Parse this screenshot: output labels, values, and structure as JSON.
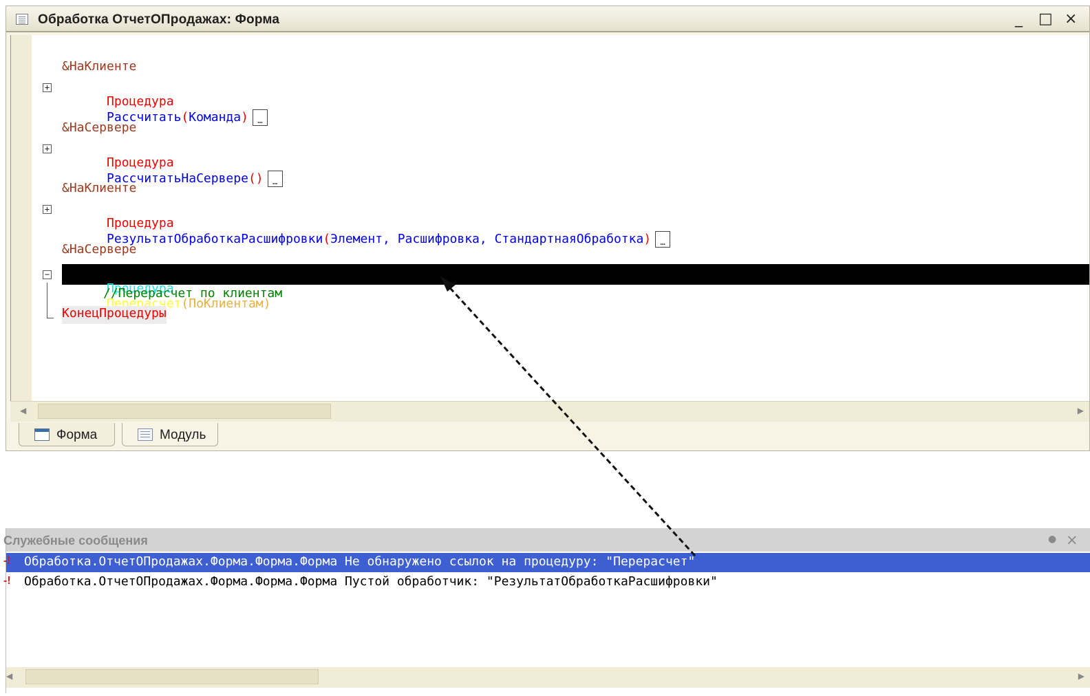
{
  "window": {
    "title": "Обработка ОтчетОПродажах: Форма",
    "minimize": "_",
    "maximize": "□",
    "close": "×"
  },
  "code": {
    "lines": [
      {
        "directive": "&НаКлиенте"
      },
      {
        "keyword": "Процедура",
        "name": "Рассчитать",
        "open": "(",
        "params": "Команда",
        "close": ")"
      },
      {
        "directive": "&НаСервере"
      },
      {
        "keyword": "Процедура",
        "name": "РассчитатьНаСервере",
        "open": "(",
        "params": "",
        "close": ")"
      },
      {
        "directive": "&НаКлиенте"
      },
      {
        "keyword": "Процедура",
        "name": "РезультатОбработкаРасшифровки",
        "open": "(",
        "params": "Элемент, Расшифровка, СтандартнаяОбработка",
        "close": ")"
      },
      {
        "directive": "&НаСервере"
      },
      {
        "keyword": "Процедура",
        "name": "Перерасчет",
        "open": "(",
        "params": "ПоКлиентам",
        "close": ")"
      }
    ],
    "comment": "//Перерасчет по клиентам",
    "end": "КонецПроцедуры",
    "collapsed_marker": "…"
  },
  "tabs": [
    {
      "label": "Форма",
      "icon": "form-icon"
    },
    {
      "label": "Модуль",
      "icon": "module-icon"
    }
  ],
  "messages": {
    "title": "Служебные сообщения",
    "pin": "●",
    "close": "×",
    "rows": [
      {
        "icon": "-!",
        "text": "Обработка.ОтчетОПродажах.Форма.Форма.Форма Не обнаружено ссылок на процедуру: \"Перерасчет\"",
        "selected": true
      },
      {
        "icon": "-!",
        "text": "Обработка.ОтчетОПродажах.Форма.Форма.Форма Пустой обработчик: \"РезультатОбработкаРасшифровки\"",
        "selected": false
      }
    ]
  },
  "colors": {
    "selection": "#3d5fd2",
    "highlight_line": "#000000",
    "keyword": "#ee0000",
    "identifier": "#0000ee",
    "comment": "#008000"
  }
}
